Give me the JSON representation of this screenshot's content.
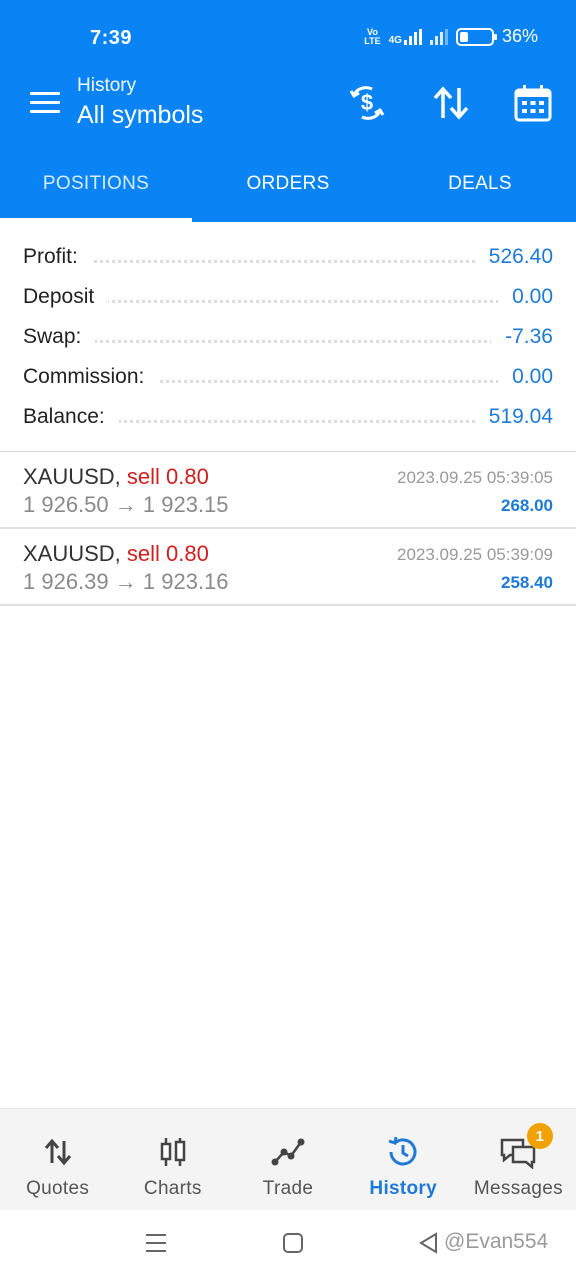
{
  "status_bar": {
    "time": "7:39",
    "network_top": "Vo",
    "network_bottom": "LTE",
    "net_type": "4G",
    "battery": "36%",
    "battery_level": 0.36
  },
  "app_bar": {
    "subtitle": "History",
    "title": "All symbols",
    "icons": [
      "menu-icon",
      "dollar-refresh-icon",
      "sort-icon",
      "calendar-icon"
    ]
  },
  "tabs": [
    {
      "label": "POSITIONS",
      "active": true
    },
    {
      "label": "ORDERS",
      "active": false
    },
    {
      "label": "DEALS",
      "active": false
    }
  ],
  "summary": [
    {
      "label": "Profit:",
      "value": "526.40"
    },
    {
      "label": "Deposit",
      "value": "0.00"
    },
    {
      "label": "Swap:",
      "value": "-7.36"
    },
    {
      "label": "Commission:",
      "value": "0.00"
    },
    {
      "label": "Balance:",
      "value": "519.04"
    }
  ],
  "deals": [
    {
      "symbol": "XAUUSD,",
      "side": "sell 0.80",
      "open_price": "1 926.50",
      "arrow": "→",
      "close_price": "1 923.15",
      "time": "2023.09.25 05:39:05",
      "profit": "268.00"
    },
    {
      "symbol": "XAUUSD,",
      "side": "sell 0.80",
      "open_price": "1 926.39",
      "arrow": "→",
      "close_price": "1 923.16",
      "time": "2023.09.25 05:39:09",
      "profit": "258.40"
    }
  ],
  "bottom_nav": [
    {
      "label": "Quotes",
      "icon": "quotes-icon",
      "active": false
    },
    {
      "label": "Charts",
      "icon": "charts-icon",
      "active": false
    },
    {
      "label": "Trade",
      "icon": "trade-icon",
      "active": false
    },
    {
      "label": "History",
      "icon": "history-icon",
      "active": true
    },
    {
      "label": "Messages",
      "icon": "messages-icon",
      "active": false,
      "badge": "1"
    }
  ],
  "watermark": "@Evan554",
  "colors": {
    "primary": "#0a84f5",
    "value_blue": "#1e7ad6",
    "sell_red": "#d11f1f",
    "badge_orange": "#f2a200"
  }
}
